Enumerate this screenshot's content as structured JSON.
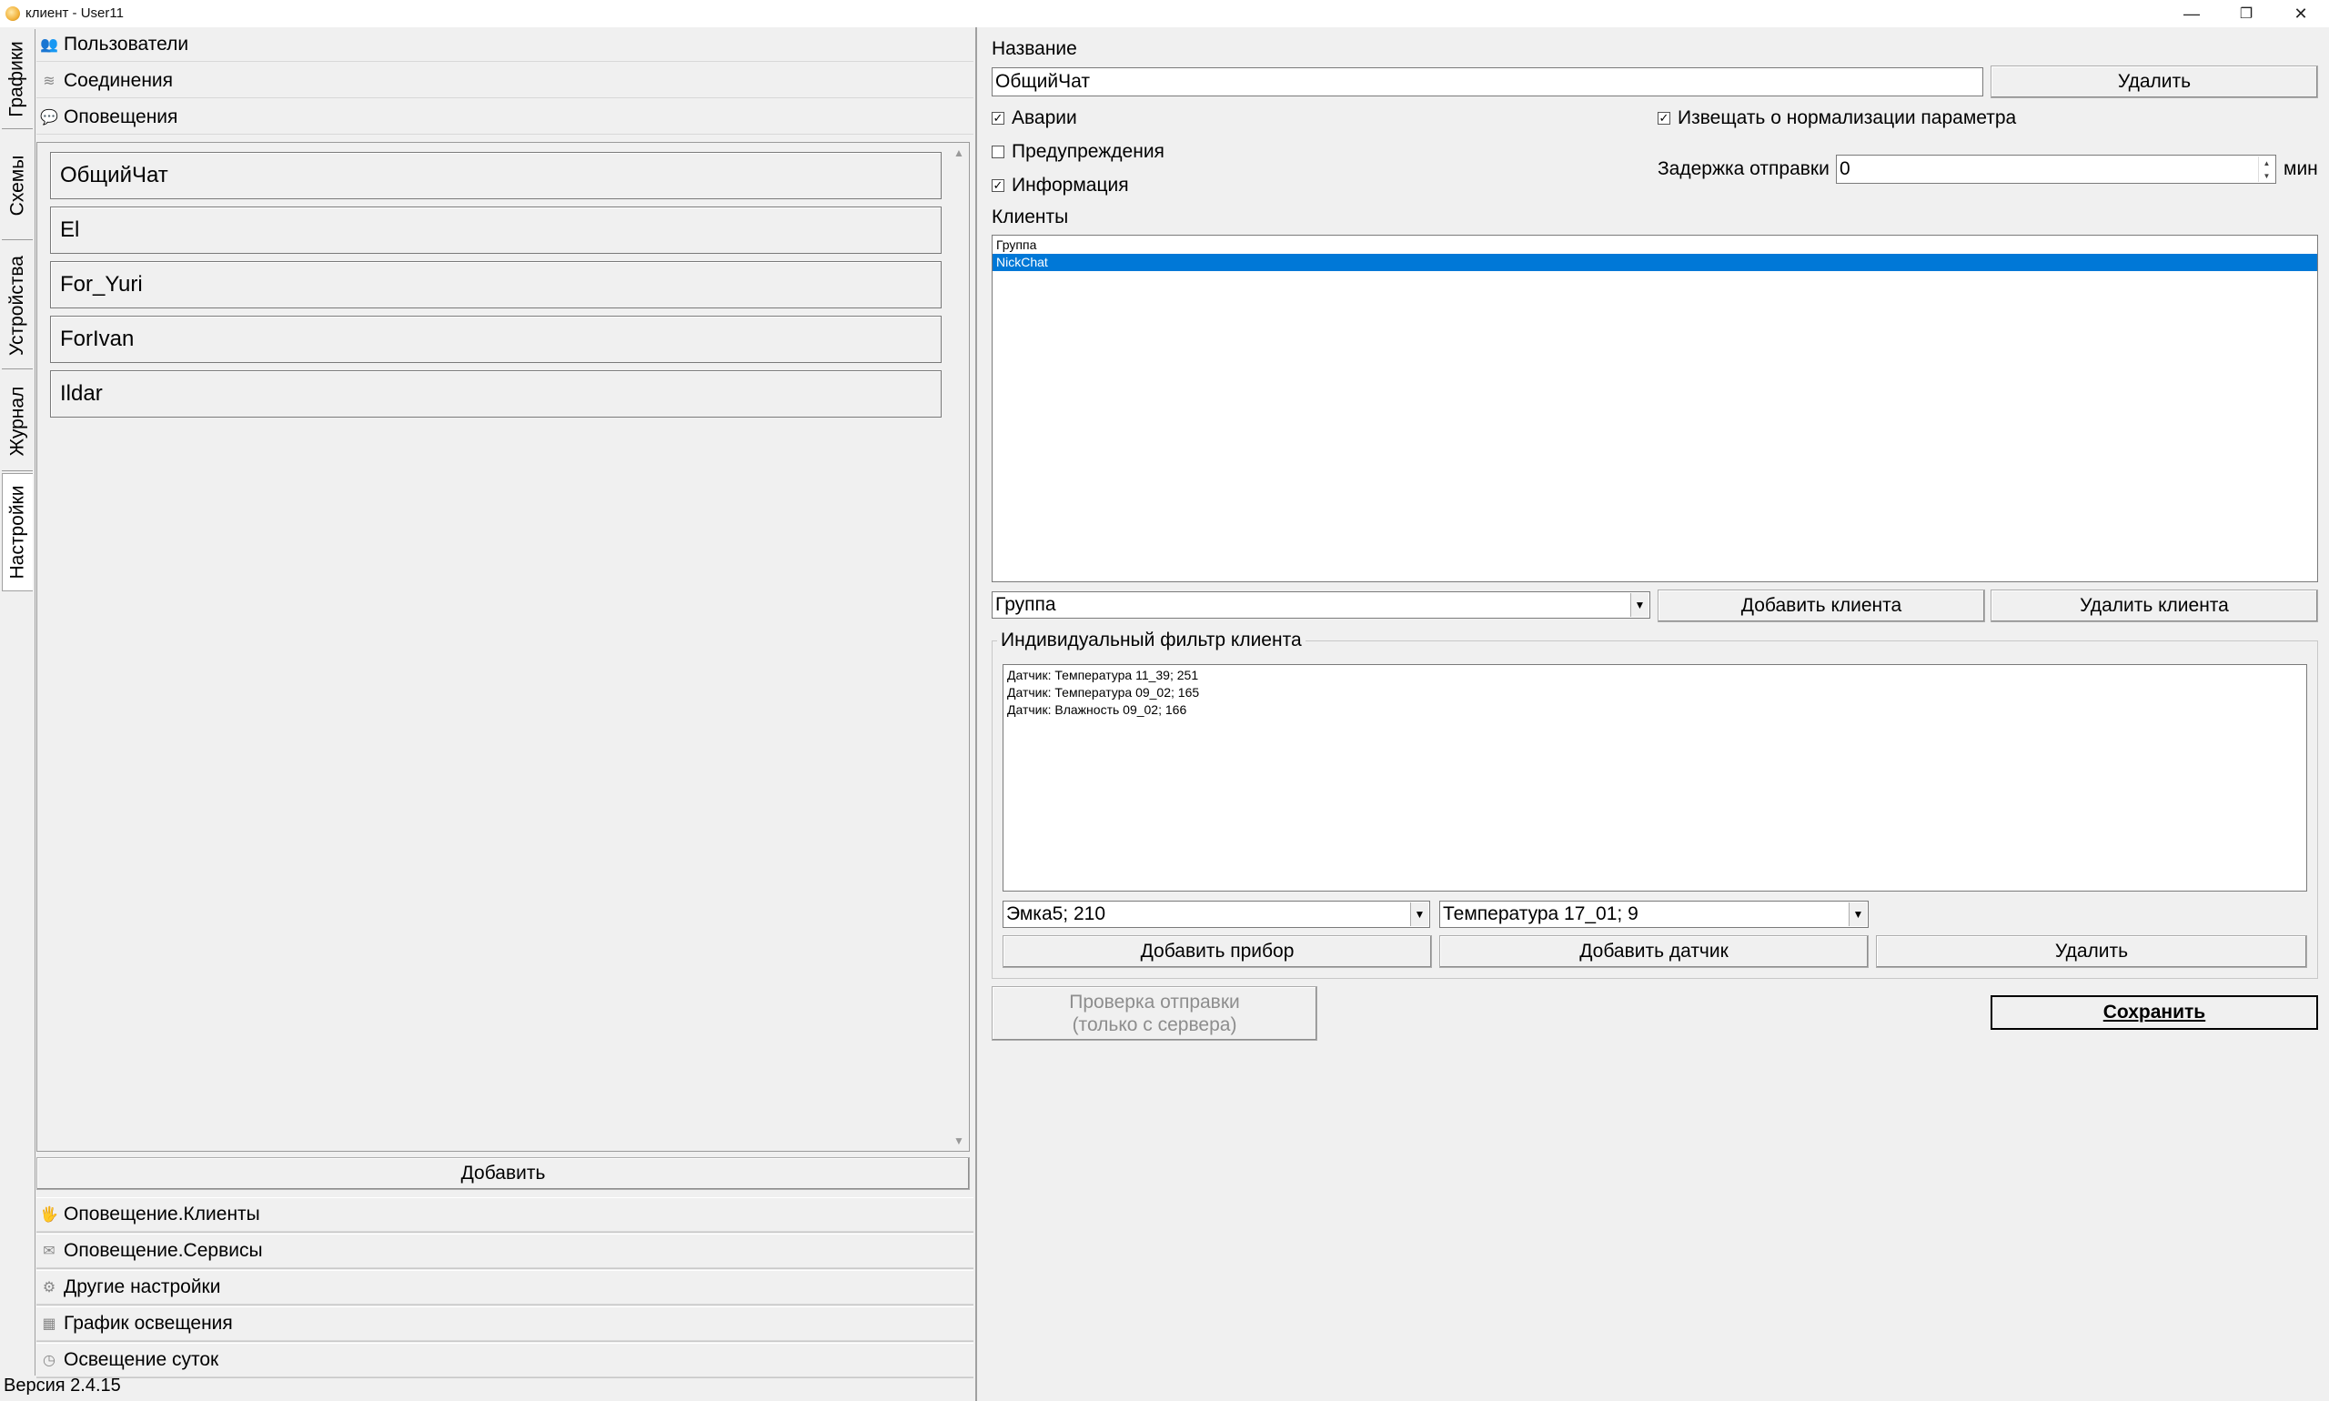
{
  "window": {
    "title": "клиент - User11",
    "minimize": "—",
    "restore": "❐",
    "close": "✕"
  },
  "vertical_tabs": [
    "Графики",
    "Схемы",
    "Устройства",
    "Журнал",
    "Настройки"
  ],
  "active_tab": "Настройки",
  "sections_top": [
    {
      "label": "Пользователи",
      "icon": "users-icon"
    },
    {
      "label": "Соединения",
      "icon": "connections-icon"
    },
    {
      "label": "Оповещения",
      "icon": "chat-bubble-icon"
    }
  ],
  "notification_list": [
    "ОбщийЧат",
    "El",
    "For_Yuri",
    "ForIvan",
    "Ildar"
  ],
  "add_button": "Добавить",
  "sections_bottom": [
    {
      "label": "Оповещение.Клиенты",
      "icon": "client-icon"
    },
    {
      "label": "Оповещение.Сервисы",
      "icon": "mail-icon"
    },
    {
      "label": "Другие настройки",
      "icon": "gear-icon"
    },
    {
      "label": "График освещения",
      "icon": "calendar-icon"
    },
    {
      "label": "Освещение суток",
      "icon": "clock-icon"
    }
  ],
  "version": "Версия 2.4.15",
  "detail": {
    "name_label": "Название",
    "name_value": "ОбщийЧат",
    "delete_button": "Удалить",
    "checkboxes": [
      {
        "label": "Аварии",
        "checked": true
      },
      {
        "label": "Предупреждения",
        "checked": false
      },
      {
        "label": "Информация",
        "checked": true
      }
    ],
    "normalize_checkbox": {
      "label": "Извещать о нормализации параметра",
      "checked": true
    },
    "delay_label": "Задержка отправки",
    "delay_value": "0",
    "delay_unit": "мин",
    "clients_label": "Клиенты",
    "clients": [
      {
        "name": "Группа",
        "selected": false
      },
      {
        "name": "NickChat",
        "selected": true
      }
    ],
    "client_type_combo": "Группа",
    "add_client_button": "Добавить клиента",
    "remove_client_button": "Удалить клиента",
    "filter_group_title": "Индивидуальный фильтр клиента",
    "filter_items": [
      "Датчик: Температура 11_39; 251",
      "Датчик: Температура 09_02; 165",
      "Датчик: Влажность 09_02; 166"
    ],
    "device_combo": "Эмка5; 210",
    "sensor_combo": "Температура 17_01; 9",
    "add_device_button": "Добавить прибор",
    "add_sensor_button": "Добавить датчик",
    "filter_delete_button": "Удалить",
    "check_send_line1": "Проверка отправки",
    "check_send_line2": "(только с сервера)",
    "save_button": "Сохранить"
  }
}
